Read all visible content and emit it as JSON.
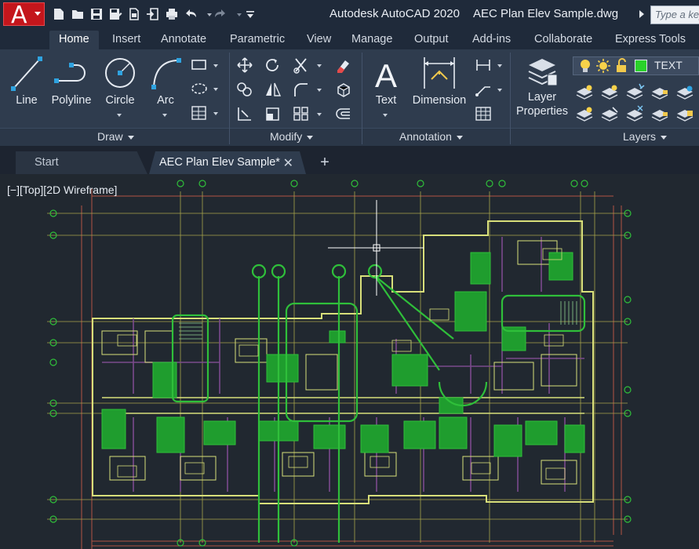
{
  "app": {
    "logo_letter": "A",
    "title": "Autodesk AutoCAD 2020",
    "file": "AEC Plan Elev Sample.dwg",
    "search_placeholder": "Type a keyword"
  },
  "quick_access": [
    "new-icon",
    "open-icon",
    "save-icon",
    "save-as-icon",
    "publish-icon",
    "import-icon",
    "plot-icon",
    "undo-icon",
    "redo-icon",
    "customize-icon"
  ],
  "ribbon_tabs": [
    "Home",
    "Insert",
    "Annotate",
    "Parametric",
    "View",
    "Manage",
    "Output",
    "Add-ins",
    "Collaborate",
    "Express Tools"
  ],
  "active_tab": "Home",
  "panels": {
    "draw": {
      "title": "Draw",
      "buttons": [
        "Line",
        "Polyline",
        "Circle",
        "Arc"
      ]
    },
    "modify": {
      "title": "Modify"
    },
    "annotation": {
      "title": "Annotation",
      "buttons": [
        "Text",
        "Dimension"
      ]
    },
    "layers": {
      "title": "Layers",
      "button_line1": "Layer",
      "button_line2": "Properties",
      "current_layer": "TEXT"
    }
  },
  "file_tabs": {
    "start": "Start",
    "active": "AEC Plan Elev Sample*",
    "close": "✕",
    "new": "+"
  },
  "viewport": {
    "label": "[−][Top][2D Wireframe]"
  },
  "colors": {
    "title_bar": "#1f2a3a",
    "ribbon": "#2f3c4e",
    "canvas": "#212830",
    "wall": "#d8df7a",
    "fixture": "#2fbf3a",
    "grid": "#b25544",
    "partition": "#7b4a8c"
  }
}
